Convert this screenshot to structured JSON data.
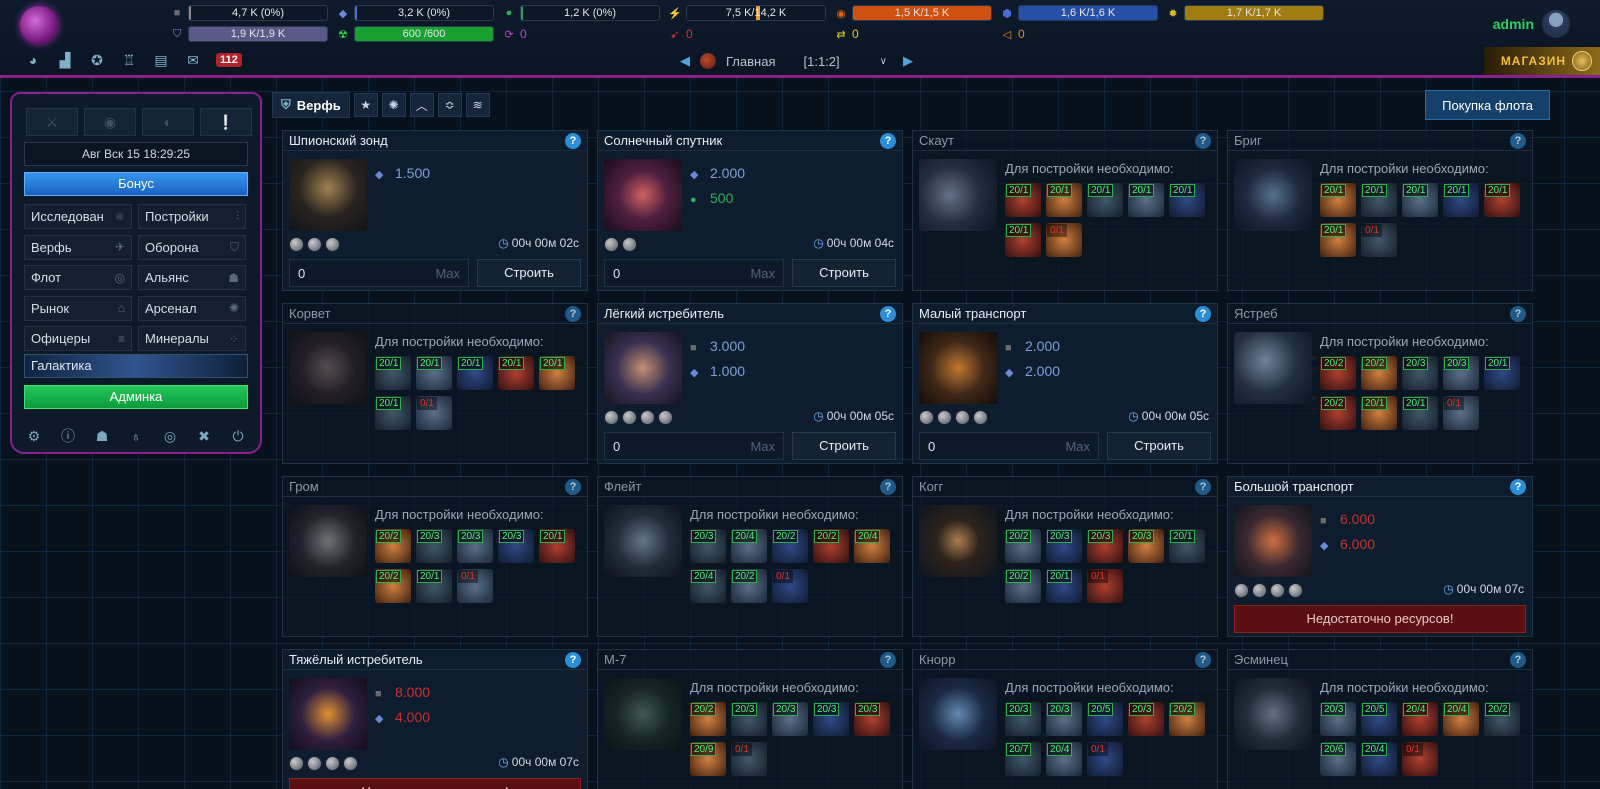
{
  "user": {
    "name": "admin"
  },
  "resources": {
    "row1": [
      {
        "icon": "metal-icon",
        "text": "4,7 K (0%)",
        "fill": 0,
        "color": "#8a8a8a"
      },
      {
        "icon": "crystal-icon",
        "text": "3,2 K (0%)",
        "fill": 0,
        "color": "#4a72c8"
      },
      {
        "icon": "deuterium-icon",
        "text": "1,2 K (0%)",
        "fill": 0,
        "color": "#2aa05a"
      },
      {
        "icon": "energy-icon",
        "text": "7,5 K/14,2 K",
        "fill": 0.53,
        "color": "#e0a040"
      },
      {
        "icon": "orange-orb-icon",
        "text": "1,5 K/1,5 K",
        "fill": 1,
        "color": "#d05010"
      },
      {
        "icon": "blue-shield-icon",
        "text": "1,6 K/1,6 K",
        "fill": 1,
        "color": "#2650a8"
      },
      {
        "icon": "gold-gear-icon",
        "text": "1,7 K/1,7 K",
        "fill": 1,
        "color": "#a07c10"
      }
    ],
    "row2": [
      {
        "icon": "shield-icon",
        "text": "1,9 K/1,9 K",
        "fill": 1,
        "color": "#5a5a88"
      },
      {
        "icon": "radiation-icon",
        "text": "600 /600",
        "fill": 1,
        "color": "#18a030"
      },
      {
        "icon": "cycle-icon",
        "text": "0"
      },
      {
        "icon": "red-rocket-icon",
        "text": "0"
      },
      {
        "icon": "yellow-arrows-icon",
        "text": "0"
      },
      {
        "icon": "orange-horn-icon",
        "text": "0"
      }
    ]
  },
  "nav": {
    "messages_count": "112",
    "planet_name": "Главная",
    "planet_coords": "[1:1:2]",
    "shop_label": "МАГАЗИН"
  },
  "left_panel": {
    "datetime": "Авг Вск 15 18:29:25",
    "bonus": "Бонус",
    "menu": [
      {
        "label": "Исследован",
        "icon": "atom-icon"
      },
      {
        "label": "Постройки",
        "icon": "sliders-icon"
      },
      {
        "label": "Верфь",
        "icon": "ship-icon"
      },
      {
        "label": "Оборона",
        "icon": "shield-icon"
      },
      {
        "label": "Флот",
        "icon": "target-icon"
      },
      {
        "label": "Альянс",
        "icon": "group-icon"
      },
      {
        "label": "Рынок",
        "icon": "tag-icon"
      },
      {
        "label": "Арсенал",
        "icon": "sun-icon"
      },
      {
        "label": "Офицеры",
        "icon": "rank-icon"
      },
      {
        "label": "Минералы",
        "icon": "molecule-icon"
      }
    ],
    "galaxy": "Галактика",
    "admin": "Админка"
  },
  "shipyard": {
    "title": "Верфь",
    "buy_fleet": "Покупка флота",
    "need_label": "Для постройки необходимо:",
    "build_label": "Строить",
    "max_label": "Max",
    "qty_value": "0",
    "lack_label": "Недостаточно ресурсов!"
  },
  "ships": [
    {
      "name": "Шпионский зонд",
      "state": "buildable",
      "costs": [
        {
          "type": "crystal",
          "value": "1.500"
        }
      ],
      "time": "00ч 00м 02с",
      "icons": 3
    },
    {
      "name": "Солнечный спутник",
      "state": "buildable",
      "costs": [
        {
          "type": "crystal",
          "value": "2.000"
        },
        {
          "type": "deuterium",
          "value": "500"
        }
      ],
      "time": "00ч 00м 04с",
      "icons": 2
    },
    {
      "name": "Скаут",
      "state": "locked",
      "reqs": [
        "20/1",
        "20/1",
        "20/1",
        "20/1",
        "20/1",
        "20/1",
        "0/1"
      ]
    },
    {
      "name": "Бриг",
      "state": "locked",
      "reqs": [
        "20/1",
        "20/1",
        "20/1",
        "20/1",
        "20/1",
        "20/1",
        "0/1"
      ]
    },
    {
      "name": "Корвет",
      "state": "locked",
      "reqs": [
        "20/1",
        "20/1",
        "20/1",
        "20/1",
        "20/1",
        "20/1",
        "0/1"
      ]
    },
    {
      "name": "Лёгкий истребитель",
      "state": "buildable",
      "costs": [
        {
          "type": "metal",
          "value": "3.000"
        },
        {
          "type": "crystal",
          "value": "1.000"
        }
      ],
      "time": "00ч 00м 05с",
      "icons": 4
    },
    {
      "name": "Малый транспорт",
      "state": "buildable",
      "costs": [
        {
          "type": "metal",
          "value": "2.000"
        },
        {
          "type": "crystal",
          "value": "2.000"
        }
      ],
      "time": "00ч 00м 05с",
      "icons": 4
    },
    {
      "name": "Ястреб",
      "state": "locked",
      "reqs": [
        "20/2",
        "20/2",
        "20/3",
        "20/3",
        "20/1",
        "20/2",
        "20/1",
        "20/1",
        "0/1"
      ]
    },
    {
      "name": "Гром",
      "state": "locked",
      "reqs": [
        "20/2",
        "20/3",
        "20/3",
        "20/3",
        "20/1",
        "20/2",
        "20/1",
        "0/1"
      ]
    },
    {
      "name": "Флейт",
      "state": "locked",
      "reqs": [
        "20/3",
        "20/4",
        "20/2",
        "20/2",
        "20/4",
        "20/4",
        "20/2",
        "0/1"
      ]
    },
    {
      "name": "Когг",
      "state": "locked",
      "reqs": [
        "20/2",
        "20/3",
        "20/3",
        "20/3",
        "20/1",
        "20/2",
        "20/1",
        "0/1"
      ]
    },
    {
      "name": "Большой транспорт",
      "state": "lacking",
      "costs": [
        {
          "type": "metal",
          "value": "6.000"
        },
        {
          "type": "crystal",
          "value": "6.000"
        }
      ],
      "time": "00ч 00м 07с",
      "icons": 4
    },
    {
      "name": "Тяжёлый истребитель",
      "state": "lacking",
      "costs": [
        {
          "type": "metal",
          "value": "8.000"
        },
        {
          "type": "crystal",
          "value": "4.000"
        }
      ],
      "time": "00ч 00м 07с",
      "icons": 4
    },
    {
      "name": "М-7",
      "state": "locked",
      "reqs": [
        "20/2",
        "20/3",
        "20/3",
        "20/3",
        "20/3",
        "20/9",
        "0/1"
      ]
    },
    {
      "name": "Кнорр",
      "state": "locked",
      "reqs": [
        "20/3",
        "20/3",
        "20/5",
        "20/3",
        "20/2",
        "20/7",
        "20/4",
        "0/1"
      ]
    },
    {
      "name": "Эсминец",
      "state": "locked",
      "reqs": [
        "20/3",
        "20/5",
        "20/4",
        "20/4",
        "20/2",
        "20/6",
        "20/4",
        "0/1"
      ]
    }
  ]
}
